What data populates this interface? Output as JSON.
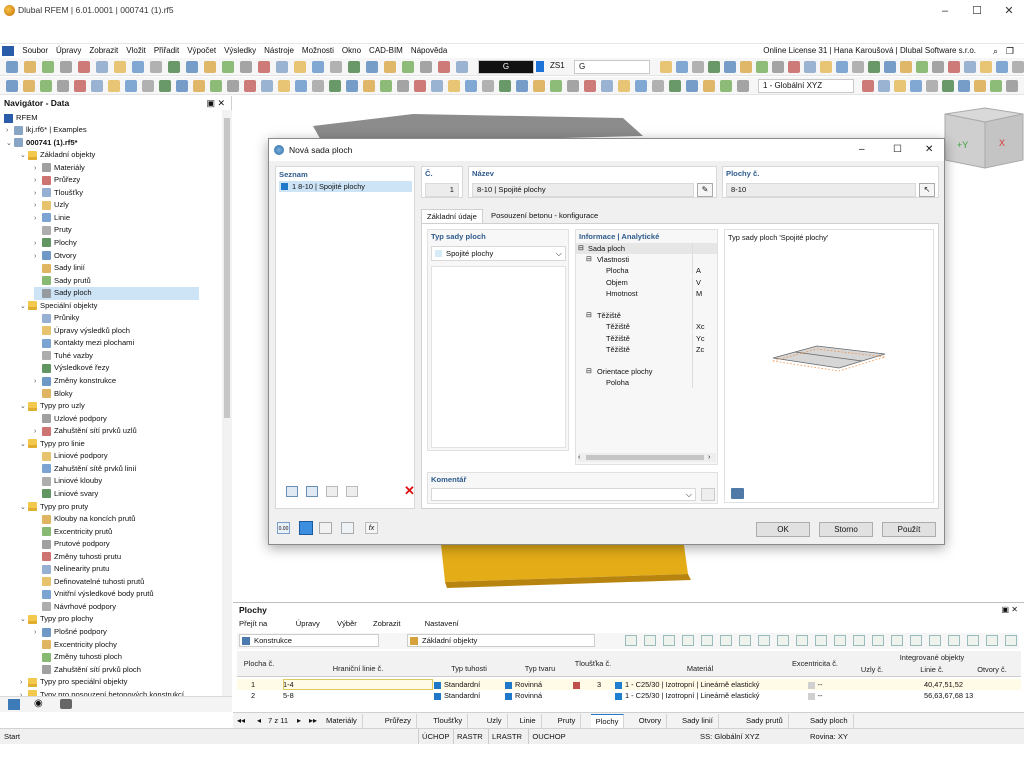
{
  "window": {
    "title": "Dlubal RFEM | 6.01.0001 | 000741 (1).rf5"
  },
  "menu": {
    "items": [
      "Soubor",
      "Úpravy",
      "Zobrazit",
      "Vložit",
      "Přiřadit",
      "Výpočet",
      "Výsledky",
      "Nástroje",
      "Možnosti",
      "Okno",
      "CAD-BIM",
      "Nápověda"
    ],
    "license": "Online License 31 | Hana Karoušová | Dlubal Software s.r.o."
  },
  "toolbar": {
    "loadcase_code": "G",
    "loadcase_id": "ZS1",
    "loadcase_name": "G",
    "coord_system": "1 - Globální XYZ"
  },
  "navigator": {
    "title": "Navigátor - Data",
    "root": "RFEM",
    "items": [
      {
        "label": "lkj.rf6* | Examples",
        "level": 1,
        "exp": ">"
      },
      {
        "label": "000741 (1).rf5*",
        "level": 1,
        "exp": "v",
        "bold": true
      },
      {
        "label": "Základní objekty",
        "level": 2,
        "exp": "v",
        "folder": true
      },
      {
        "label": "Materiály",
        "level": 3,
        "exp": ">"
      },
      {
        "label": "Průřezy",
        "level": 3,
        "exp": ">"
      },
      {
        "label": "Tloušťky",
        "level": 3,
        "exp": ">"
      },
      {
        "label": "Uzly",
        "level": 3,
        "exp": ">"
      },
      {
        "label": "Linie",
        "level": 3,
        "exp": ">"
      },
      {
        "label": "Pruty",
        "level": 3,
        "exp": ""
      },
      {
        "label": "Plochy",
        "level": 3,
        "exp": ">"
      },
      {
        "label": "Otvory",
        "level": 3,
        "exp": ">"
      },
      {
        "label": "Sady linií",
        "level": 3,
        "exp": ""
      },
      {
        "label": "Sady prutů",
        "level": 3,
        "exp": ""
      },
      {
        "label": "Sady ploch",
        "level": 3,
        "exp": "",
        "selected": true
      },
      {
        "label": "Speciální objekty",
        "level": 2,
        "exp": "v",
        "folder": true
      },
      {
        "label": "Průniky",
        "level": 3,
        "exp": ""
      },
      {
        "label": "Úpravy výsledků ploch",
        "level": 3,
        "exp": ""
      },
      {
        "label": "Kontakty mezi plochami",
        "level": 3,
        "exp": ""
      },
      {
        "label": "Tuhé vazby",
        "level": 3,
        "exp": ""
      },
      {
        "label": "Výsledkové řezy",
        "level": 3,
        "exp": ""
      },
      {
        "label": "Změny konstrukce",
        "level": 3,
        "exp": ">"
      },
      {
        "label": "Bloky",
        "level": 3,
        "exp": ""
      },
      {
        "label": "Typy pro uzly",
        "level": 2,
        "exp": "v",
        "folder": true
      },
      {
        "label": "Uzlové podpory",
        "level": 3,
        "exp": ""
      },
      {
        "label": "Zahuštění sítí prvků uzlů",
        "level": 3,
        "exp": ">"
      },
      {
        "label": "Typy pro linie",
        "level": 2,
        "exp": "v",
        "folder": true
      },
      {
        "label": "Liniové podpory",
        "level": 3,
        "exp": ""
      },
      {
        "label": "Zahuštění sítě prvků linií",
        "level": 3,
        "exp": ""
      },
      {
        "label": "Liniové klouby",
        "level": 3,
        "exp": ""
      },
      {
        "label": "Liniové svary",
        "level": 3,
        "exp": ""
      },
      {
        "label": "Typy pro pruty",
        "level": 2,
        "exp": "v",
        "folder": true
      },
      {
        "label": "Klouby na koncích prutů",
        "level": 3,
        "exp": ""
      },
      {
        "label": "Excentricity prutů",
        "level": 3,
        "exp": ""
      },
      {
        "label": "Prutové podpory",
        "level": 3,
        "exp": ""
      },
      {
        "label": "Změny tuhosti prutu",
        "level": 3,
        "exp": ""
      },
      {
        "label": "Nelinearity prutu",
        "level": 3,
        "exp": ""
      },
      {
        "label": "Definovatelné tuhosti prutů",
        "level": 3,
        "exp": ""
      },
      {
        "label": "Vnitřní výsledkové body prutů",
        "level": 3,
        "exp": ""
      },
      {
        "label": "Návrhové podpory",
        "level": 3,
        "exp": ""
      },
      {
        "label": "Typy pro plochy",
        "level": 2,
        "exp": "v",
        "folder": true
      },
      {
        "label": "Plošné podpory",
        "level": 3,
        "exp": ">"
      },
      {
        "label": "Excentricity plochy",
        "level": 3,
        "exp": ""
      },
      {
        "label": "Změny tuhosti ploch",
        "level": 3,
        "exp": ""
      },
      {
        "label": "Zahuštění sítí prvků ploch",
        "level": 3,
        "exp": ""
      },
      {
        "label": "Typy pro speciální objekty",
        "level": 2,
        "exp": ">",
        "folder": true
      },
      {
        "label": "Typy pro posouzení betonových konstrukcí",
        "level": 2,
        "exp": ">",
        "folder": true
      },
      {
        "label": "Imperfekce",
        "level": 2,
        "exp": ">",
        "folder": true
      }
    ]
  },
  "dialog": {
    "title": "Nová sada ploch",
    "list_header": "Seznam",
    "list_items": [
      {
        "label": "1  8-10 | Spojité plochy"
      }
    ],
    "no_label": "Č.",
    "no_value": "1",
    "name_label": "Název",
    "name_value": "8-10 | Spojité plochy",
    "surfaces_label": "Plochy č.",
    "surfaces_value": "8-10",
    "tabs": [
      "Základní údaje",
      "Posouzení betonu - konfigurace"
    ],
    "type_label": "Typ sady ploch",
    "type_value": "Spojité plochy",
    "info_header": "Informace | Analytické",
    "info_rows": [
      {
        "label": "Sada ploch",
        "sym": "",
        "lvl": 0,
        "exp": "⊟"
      },
      {
        "label": "Vlastnosti",
        "sym": "",
        "lvl": 1,
        "exp": "⊟"
      },
      {
        "label": "Plocha",
        "sym": "A",
        "lvl": 2,
        "exp": ""
      },
      {
        "label": "Objem",
        "sym": "V",
        "lvl": 2,
        "exp": ""
      },
      {
        "label": "Hmotnost",
        "sym": "M",
        "lvl": 2,
        "exp": ""
      },
      {
        "label": "",
        "sym": "",
        "lvl": 2,
        "exp": ""
      },
      {
        "label": "Těžiště",
        "sym": "",
        "lvl": 1,
        "exp": "⊟"
      },
      {
        "label": "Těžiště",
        "sym": "Xc",
        "lvl": 2,
        "exp": ""
      },
      {
        "label": "Těžiště",
        "sym": "Yc",
        "lvl": 2,
        "exp": ""
      },
      {
        "label": "Těžiště",
        "sym": "Zc",
        "lvl": 2,
        "exp": ""
      },
      {
        "label": "",
        "sym": "",
        "lvl": 2,
        "exp": ""
      },
      {
        "label": "Orientace plochy",
        "sym": "",
        "lvl": 1,
        "exp": "⊟"
      },
      {
        "label": "Poloha",
        "sym": "",
        "lvl": 2,
        "exp": ""
      }
    ],
    "preview_label": "Typ sady ploch 'Spojité plochy'",
    "comment_label": "Komentář",
    "ok": "OK",
    "cancel": "Storno",
    "apply": "Použít"
  },
  "table": {
    "title": "Plochy",
    "menu": [
      "Přejít na",
      "Úpravy",
      "Výběr",
      "Zobrazit",
      "Nastavení"
    ],
    "combo1": "Konstrukce",
    "combo2": "Základní objekty",
    "headers": {
      "plocha": "Plocha č.",
      "hranicni": "Hraniční linie č.",
      "typ_tuhosti": "Typ tuhosti",
      "typ_tvaru": "Typ tvaru",
      "tloustka": "Tloušťka č.",
      "material": "Materiál",
      "excentricita": "Excentricita č.",
      "integrovane": "Integrované objekty",
      "uzly": "Uzly č.",
      "linie": "Linie č.",
      "otvory": "Otvory č."
    },
    "rows": [
      {
        "no": "1",
        "lines": "1-4",
        "stiff": "Standardní",
        "shape": "Rovinná",
        "thick": "3",
        "mat": "1 - C25/30 | Izotropní | Lineárně elastický",
        "ecc": "--",
        "nodes": "",
        "lin": "40,47,51,52",
        "open": ""
      },
      {
        "no": "2",
        "lines": "5-8",
        "stiff": "Standardní",
        "shape": "Rovinná",
        "thick": "",
        "mat": "1 - C25/30 | Izotropní | Lineárně elastický",
        "ecc": "--",
        "nodes": "",
        "lin": "56,63,67,68",
        "open": "13"
      }
    ],
    "pager": "7 z 11",
    "sheets": [
      "Materiály",
      "Průřezy",
      "Tloušťky",
      "Uzly",
      "Linie",
      "Pruty",
      "Plochy",
      "Otvory",
      "Sady linií",
      "Sady prutů",
      "Sady ploch"
    ],
    "active_sheet": "Plochy"
  },
  "status": {
    "start": "Start",
    "toggles": [
      "ÚCHOP",
      "RASTR",
      "LRASTR",
      "OUCHOP"
    ],
    "cs": "SS: Globální XYZ",
    "plane": "Rovina: XY"
  },
  "colors": {
    "accent": "#1f78c8",
    "selection": "#cde4f7",
    "material": "#1e7fd0",
    "thickness": "#c0504d"
  }
}
